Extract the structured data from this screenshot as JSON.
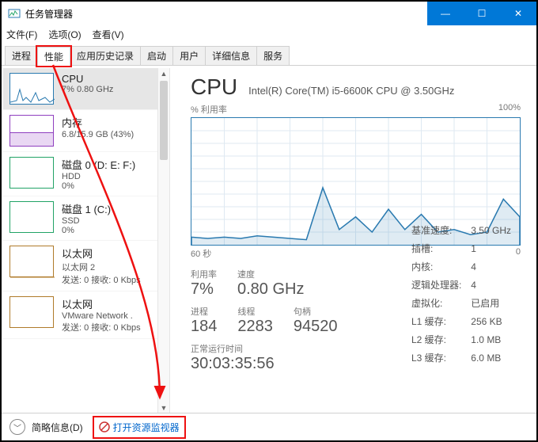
{
  "window": {
    "title": "任务管理器"
  },
  "window_buttons": {
    "min": "—",
    "max": "☐",
    "close": "✕"
  },
  "menu": {
    "file": "文件(F)",
    "options": "选项(O)",
    "view": "查看(V)"
  },
  "tabs": {
    "processes": "进程",
    "performance": "性能",
    "app_history": "应用历史记录",
    "startup": "启动",
    "users": "用户",
    "details": "详细信息",
    "services": "服务"
  },
  "side": {
    "cpu": {
      "title": "CPU",
      "line": "7% 0.80 GHz"
    },
    "mem": {
      "title": "内存",
      "line": "6.8/15.9 GB (43%)"
    },
    "disk0": {
      "title": "磁盘 0 (D: E: F:)",
      "sub": "HDD",
      "line": "0%"
    },
    "disk1": {
      "title": "磁盘 1 (C:)",
      "sub": "SSD",
      "line": "0%"
    },
    "eth0": {
      "title": "以太网",
      "sub": "以太网 2",
      "line": "发送: 0 接收: 0 Kbps"
    },
    "eth1": {
      "title": "以太网",
      "sub": "VMware Network .",
      "line": "发送: 0 接收: 0 Kbps"
    }
  },
  "panel": {
    "name": "CPU",
    "model": "Intel(R) Core(TM) i5-6600K CPU @ 3.50GHz",
    "y_label": "% 利用率",
    "y_max": "100%",
    "x_left": "60 秒",
    "x_right": "0",
    "util_label": "利用率",
    "util_value": "7%",
    "speed_label": "速度",
    "speed_value": "0.80 GHz",
    "proc_label": "进程",
    "proc_value": "184",
    "thread_label": "线程",
    "thread_value": "2283",
    "handle_label": "句柄",
    "handle_value": "94520",
    "uptime_label": "正常运行时间",
    "uptime_value": "30:03:35:56",
    "kv": {
      "base_l": "基准速度:",
      "base_v": "3.50 GHz",
      "sock_l": "插槽:",
      "sock_v": "1",
      "core_l": "内核:",
      "core_v": "4",
      "lp_l": "逻辑处理器:",
      "lp_v": "4",
      "virt_l": "虚拟化:",
      "virt_v": "已启用",
      "l1_l": "L1 缓存:",
      "l1_v": "256 KB",
      "l2_l": "L2 缓存:",
      "l2_v": "1.0 MB",
      "l3_l": "L3 缓存:",
      "l3_v": "6.0 MB"
    }
  },
  "footer": {
    "brief": "简略信息(D)",
    "resmon": "打开资源监视器"
  },
  "chart_data": {
    "type": "line",
    "title": "% 利用率",
    "xlabel": "秒",
    "ylabel": "% 利用率",
    "xlim": [
      60,
      0
    ],
    "ylim": [
      0,
      100
    ],
    "x": [
      60,
      57,
      54,
      51,
      48,
      45,
      42,
      39,
      36,
      33,
      30,
      27,
      24,
      21,
      18,
      15,
      12,
      9,
      6,
      3,
      0
    ],
    "values": [
      6,
      5,
      6,
      5,
      7,
      6,
      5,
      4,
      45,
      12,
      22,
      10,
      28,
      12,
      24,
      10,
      12,
      8,
      10,
      36,
      22
    ]
  },
  "colors": {
    "cpu": "#2a7ab0",
    "mem": "#8f3fbf",
    "disk": "#21a366",
    "net": "#b07b2a",
    "annotate": "#e11"
  }
}
